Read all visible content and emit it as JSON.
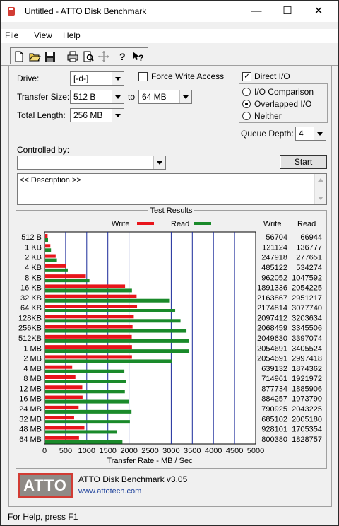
{
  "window": {
    "title": "Untitled - ATTO Disk Benchmark",
    "minimize": "—",
    "maximize": "☐",
    "close": "✕"
  },
  "menu": {
    "file": "File",
    "view": "View",
    "help": "Help"
  },
  "toolbar": [
    "new-icon",
    "open-icon",
    "save-icon",
    "print-icon",
    "print-preview-icon",
    "move-icon",
    "help-icon",
    "context-help-icon"
  ],
  "form": {
    "drive_label": "Drive:",
    "drive_value": "[-d-]",
    "force_write_label": "Force Write Access",
    "direct_io_label": "Direct I/O",
    "transfer_size_label": "Transfer Size:",
    "transfer_from": "512 B",
    "to_label": "to",
    "transfer_to": "64 MB",
    "total_length_label": "Total Length:",
    "total_length_value": "256 MB",
    "io_comparison_label": "I/O Comparison",
    "overlapped_io_label": "Overlapped I/O",
    "neither_label": "Neither",
    "queue_depth_label": "Queue Depth:",
    "queue_depth_value": "4",
    "controlled_by_label": "Controlled by:",
    "start_label": "Start",
    "description_value": "<< Description >>"
  },
  "results": {
    "title": "Test Results",
    "legend_write": "Write",
    "legend_read": "Read",
    "col_write": "Write",
    "col_read": "Read",
    "xlabel": "Transfer Rate - MB / Sec"
  },
  "chart_data": {
    "type": "bar",
    "orientation": "horizontal",
    "categories": [
      "512 B",
      "1 KB",
      "2 KB",
      "4 KB",
      "8 KB",
      "16 KB",
      "32 KB",
      "64 KB",
      "128KB",
      "256KB",
      "512KB",
      "1 MB",
      "2 MB",
      "4 MB",
      "8 MB",
      "12 MB",
      "16 MB",
      "24 MB",
      "32 MB",
      "48 MB",
      "64 MB"
    ],
    "series": [
      {
        "name": "Write",
        "color": "#e8151b",
        "values": [
          56704,
          121124,
          247918,
          485122,
          962052,
          1891336,
          2163867,
          2174814,
          2097412,
          2068459,
          2049630,
          2054691,
          2054691,
          639132,
          714961,
          877734,
          884257,
          790925,
          685102,
          928101,
          800380
        ]
      },
      {
        "name": "Read",
        "color": "#1a8a2a",
        "values": [
          66944,
          136777,
          277651,
          534274,
          1047592,
          2054225,
          2951217,
          3077740,
          3203634,
          3345506,
          3397074,
          3405524,
          2997418,
          1874362,
          1921972,
          1885906,
          1973790,
          2043225,
          2005180,
          1705354,
          1828757
        ]
      }
    ],
    "xlim": [
      0,
      5000
    ],
    "xticks": [
      "0",
      "500",
      "1000",
      "1500",
      "2000",
      "2500",
      "3000",
      "3500",
      "4000",
      "4500",
      "5000"
    ],
    "xlabel": "Transfer Rate - MB / Sec",
    "legend": "top"
  },
  "footer": {
    "logo": "ATTO",
    "product": "ATTO Disk Benchmark v3.05",
    "url": "www.attotech.com"
  },
  "status": {
    "text": "For Help, press F1"
  }
}
